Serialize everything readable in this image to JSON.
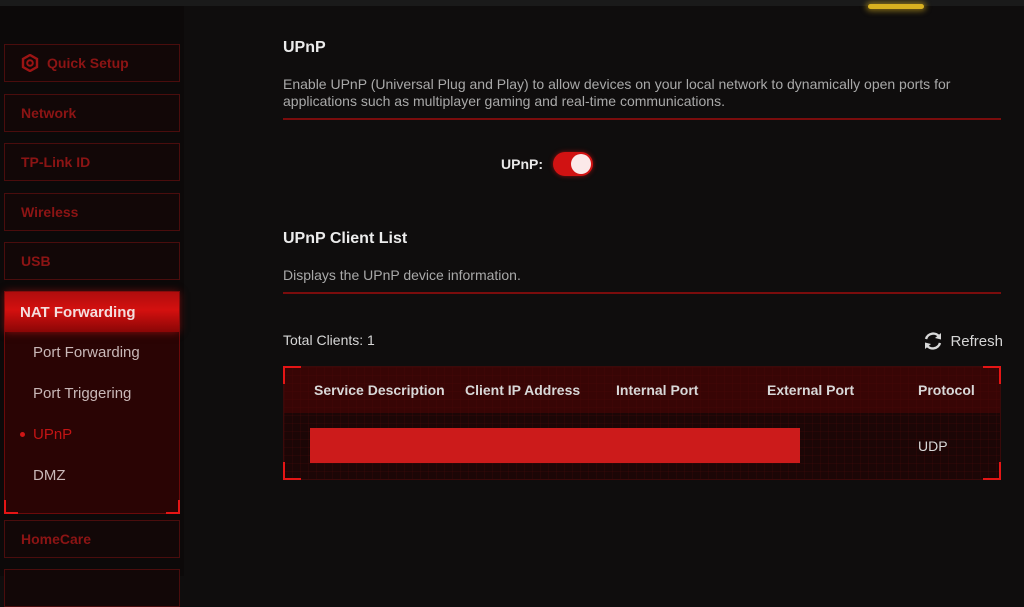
{
  "sidebar": {
    "items": [
      {
        "label": "Quick Setup",
        "icon": "gear-icon"
      },
      {
        "label": "Network"
      },
      {
        "label": "TP-Link ID"
      },
      {
        "label": "Wireless"
      },
      {
        "label": "USB"
      },
      {
        "label": "NAT Forwarding",
        "expanded": true,
        "children": [
          {
            "label": "Port Forwarding"
          },
          {
            "label": "Port Triggering"
          },
          {
            "label": "UPnP",
            "active": true
          },
          {
            "label": "DMZ"
          }
        ]
      },
      {
        "label": "HomeCare"
      }
    ]
  },
  "upnp": {
    "title": "UPnP",
    "description": "Enable UPnP (Universal Plug and Play) to allow devices on your local network to dynamically open ports for applications such as multiplayer gaming and real-time communications.",
    "toggle_label": "UPnP:",
    "enabled": true
  },
  "client_list": {
    "title": "UPnP Client List",
    "description": "Displays the UPnP device information.",
    "total_label": "Total Clients: 1",
    "refresh_label": "Refresh",
    "columns": [
      "Service Description",
      "Client IP Address",
      "Internal Port",
      "External Port",
      "Protocol"
    ],
    "rows": [
      {
        "service_description": "[redacted]",
        "client_ip": "[redacted]",
        "internal_port": "[redacted]",
        "external_port": "[redacted]",
        "protocol": "UDP"
      }
    ]
  },
  "colors": {
    "accent": "#d11212",
    "background": "#0f0d0d",
    "redaction": "#cc1b1b"
  }
}
